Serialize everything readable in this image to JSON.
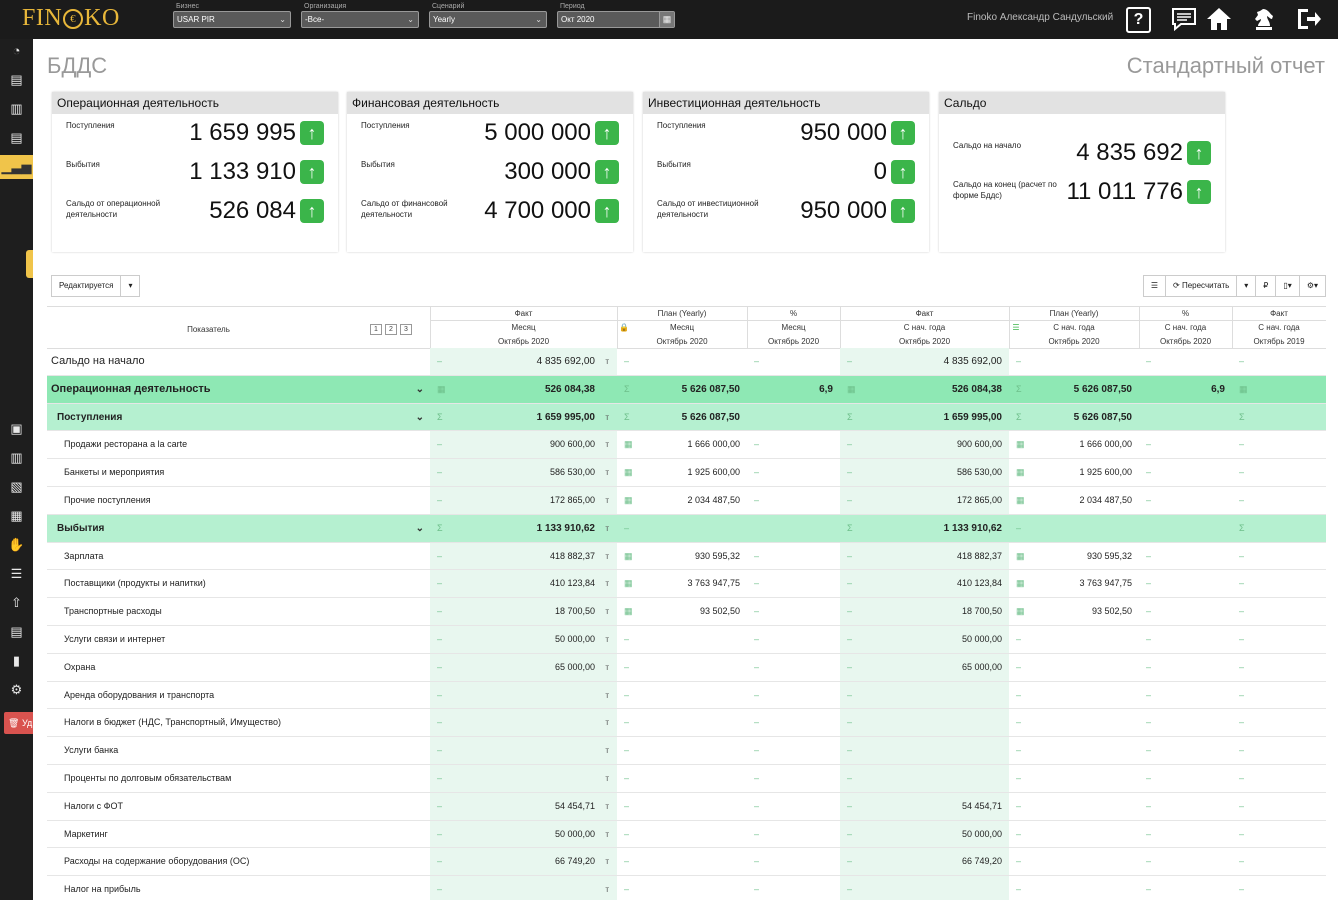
{
  "topbar": {
    "logo_left": "FIN",
    "logo_coin": "€",
    "logo_right": "KO",
    "filters": [
      {
        "label": "Бизнес",
        "value": "USAR PIR"
      },
      {
        "label": "Организация",
        "value": "-Все-"
      },
      {
        "label": "Сценарий",
        "value": "Yearly"
      },
      {
        "label": "Период",
        "value": "Окт 2020"
      }
    ],
    "user_name": "Finoko Александр Сандульский",
    "help_label": "?",
    "icons": [
      "help-icon",
      "messages-icon",
      "home-icon",
      "chess-knight-icon",
      "logout-icon"
    ]
  },
  "sidebar": {
    "icons": [
      "dashboard-icon",
      "reports-icon",
      "building-icon",
      "report2-icon",
      "bar-chart-icon",
      "presentation-icon",
      "city-icon",
      "clipboard-icon",
      "accounting-icon",
      "hand-coins-icon",
      "database-icon",
      "upload-icon",
      "invoice-icon",
      "book-icon",
      "settings-icon"
    ],
    "delete_label": "Уд"
  },
  "page": {
    "title": "БДДС",
    "report_title": "Стандартный отчет"
  },
  "cards": [
    {
      "title": "Операционная деятельность",
      "items": [
        {
          "label": "Поступления",
          "value": "1 659 995"
        },
        {
          "label": "Выбытия",
          "value": "1 133 910"
        },
        {
          "label": "Сальдо от операционной деятельности",
          "value": "526 084"
        }
      ]
    },
    {
      "title": "Финансовая деятельность",
      "items": [
        {
          "label": "Поступления",
          "value": "5 000 000"
        },
        {
          "label": "Выбытия",
          "value": "300 000"
        },
        {
          "label": "Сальдо от финансовой деятельности",
          "value": "4 700 000"
        }
      ]
    },
    {
      "title": "Инвестиционная деятельность",
      "items": [
        {
          "label": "Поступления",
          "value": "950 000"
        },
        {
          "label": "Выбытия",
          "value": "0"
        },
        {
          "label": "Сальдо от инвестиционной деятельности",
          "value": "950 000"
        }
      ]
    },
    {
      "title": "Сальдо",
      "items": [
        {
          "label": "Сальдо на начало",
          "value": "4 835 692"
        },
        {
          "label": "Сальдо на конец (расчет по форме Бддс)",
          "value": "11 011 776"
        }
      ]
    }
  ],
  "toolbar": {
    "status_label": "Редактируется",
    "recalc_label": "Пересчитать",
    "currency_symbol": "₽"
  },
  "table": {
    "indicator_header": "Показатель",
    "levels": [
      "1",
      "2",
      "3"
    ],
    "columns": [
      {
        "top": "Факт",
        "mid": "Месяц",
        "bot": "Октябрь 2020"
      },
      {
        "top": "План (Yearly)",
        "mid": "Месяц",
        "bot": "Октябрь 2020"
      },
      {
        "top": "%",
        "mid": "Месяц",
        "bot": "Октябрь 2020"
      },
      {
        "top": "Факт",
        "mid": "С нач. года",
        "bot": "Октябрь 2020"
      },
      {
        "top": "План (Yearly)",
        "mid": "С нач. года",
        "bot": "Октябрь 2020"
      },
      {
        "top": "%",
        "mid": "С нач. года",
        "bot": "Октябрь 2020"
      },
      {
        "top": "Факт",
        "mid": "С нач. года",
        "bot": "Октябрь 2019"
      }
    ],
    "rows": [
      {
        "label": "Сальдо на начало",
        "type": "plain",
        "cells": [
          "4 835 692,00",
          "",
          "",
          "4 835 692,00",
          "",
          "",
          ""
        ]
      },
      {
        "label": "Операционная деятельность",
        "type": "sec",
        "cells": [
          "526 084,38",
          "5 626 087,50",
          "6,9",
          "526 084,38",
          "5 626 087,50",
          "6,9",
          ""
        ]
      },
      {
        "label": "Поступления",
        "type": "sub",
        "cells": [
          "1 659 995,00",
          "5 626 087,50",
          "",
          "1 659 995,00",
          "5 626 087,50",
          "",
          ""
        ]
      },
      {
        "label": "Продажи ресторана a la carte",
        "type": "item",
        "cells": [
          "900 600,00",
          "1 666 000,00",
          "",
          "900 600,00",
          "1 666 000,00",
          "",
          ""
        ]
      },
      {
        "label": "Банкеты и мероприятия",
        "type": "item",
        "cells": [
          "586 530,00",
          "1 925 600,00",
          "",
          "586 530,00",
          "1 925 600,00",
          "",
          ""
        ]
      },
      {
        "label": "Прочие поступления",
        "type": "item",
        "cells": [
          "172 865,00",
          "2 034 487,50",
          "",
          "172 865,00",
          "2 034 487,50",
          "",
          ""
        ]
      },
      {
        "label": "Выбытия",
        "type": "sub",
        "cells": [
          "1 133 910,62",
          "",
          "",
          "1 133 910,62",
          "",
          "",
          ""
        ]
      },
      {
        "label": "Зарплата",
        "type": "item",
        "cells": [
          "418 882,37",
          "930 595,32",
          "",
          "418 882,37",
          "930 595,32",
          "",
          ""
        ]
      },
      {
        "label": "Поставщики (продукты и напитки)",
        "type": "item",
        "cells": [
          "410 123,84",
          "3 763 947,75",
          "",
          "410 123,84",
          "3 763 947,75",
          "",
          ""
        ]
      },
      {
        "label": "Транспортные расходы",
        "type": "item",
        "cells": [
          "18 700,50",
          "93 502,50",
          "",
          "18 700,50",
          "93 502,50",
          "",
          ""
        ]
      },
      {
        "label": "Услуги связи и интернет",
        "type": "item",
        "cells": [
          "50 000,00",
          "",
          "",
          "50 000,00",
          "",
          "",
          ""
        ]
      },
      {
        "label": "Охрана",
        "type": "item",
        "cells": [
          "65 000,00",
          "",
          "",
          "65 000,00",
          "",
          "",
          ""
        ]
      },
      {
        "label": "Аренда оборудования и транспорта",
        "type": "item",
        "cells": [
          "",
          "",
          "",
          "",
          "",
          "",
          ""
        ]
      },
      {
        "label": "Налоги в бюджет (НДС, Транспортный, Имущество)",
        "type": "item",
        "cells": [
          "",
          "",
          "",
          "",
          "",
          "",
          ""
        ]
      },
      {
        "label": "Услуги банка",
        "type": "item",
        "cells": [
          "",
          "",
          "",
          "",
          "",
          "",
          ""
        ]
      },
      {
        "label": "Проценты по долговым обязательствам",
        "type": "item",
        "cells": [
          "",
          "",
          "",
          "",
          "",
          "",
          ""
        ]
      },
      {
        "label": "Налоги с ФОТ",
        "type": "item",
        "cells": [
          "54 454,71",
          "",
          "",
          "54 454,71",
          "",
          "",
          ""
        ]
      },
      {
        "label": "Маркетинг",
        "type": "item",
        "cells": [
          "50 000,00",
          "",
          "",
          "50 000,00",
          "",
          "",
          ""
        ]
      },
      {
        "label": "Расходы на содержание оборудования (ОС)",
        "type": "item",
        "cells": [
          "66 749,20",
          "",
          "",
          "66 749,20",
          "",
          "",
          ""
        ]
      },
      {
        "label": "Налог на прибыль",
        "type": "item",
        "cells": [
          "",
          "",
          "",
          "",
          "",
          "",
          ""
        ]
      }
    ]
  }
}
